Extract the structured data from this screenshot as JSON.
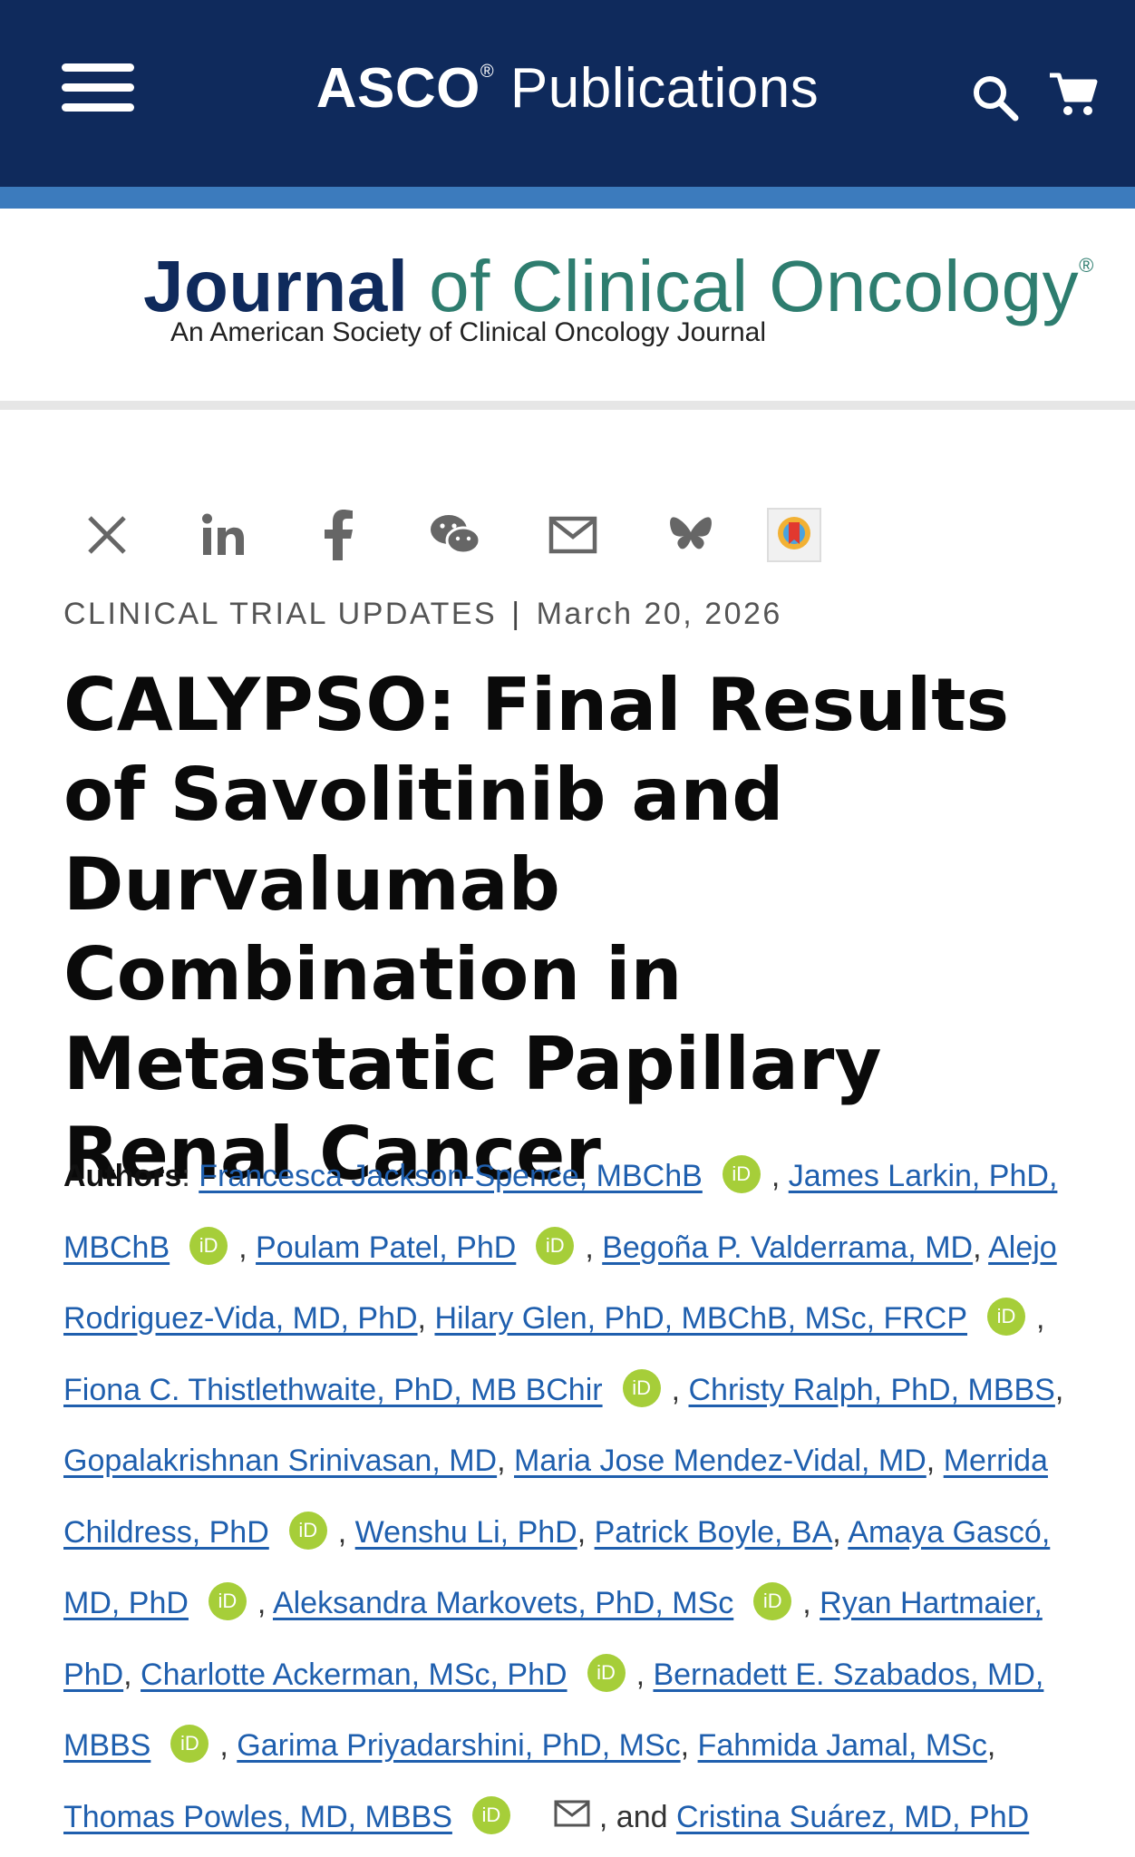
{
  "header": {
    "brand_bold": "ASCO",
    "brand_mark": "®",
    "brand_rest": " Publications",
    "menu_icon": "hamburger-icon",
    "search_icon": "search-icon",
    "cart_icon": "cart-icon"
  },
  "journal": {
    "title_bold": "Journal",
    "title_rest": " of Clinical Oncology",
    "registered": "®",
    "subtitle": "An American Society of Clinical Oncology Journal"
  },
  "share_icons": [
    "x-icon",
    "linkedin-icon",
    "facebook-icon",
    "wechat-icon",
    "email-icon",
    "bluesky-icon",
    "mendeley-icon"
  ],
  "article": {
    "category": "CLINICAL TRIAL UPDATES",
    "separator": "|",
    "date": "March 20, 2026",
    "title": "CALYPSO: Final Results of Savolitinib and Durvalumab Combination in Metastatic Papillary Renal Cancer"
  },
  "authors": {
    "label": "Authors",
    "orcid_text": "iD",
    "list": [
      "Francesca Jackson-Spence, MBChB",
      "James Larkin, PhD, MBChB",
      "Poulam Patel, PhD",
      "Begoña P. Valderrama, MD",
      "Alejo Rodriguez-Vida, MD, PhD",
      "Hilary Glen, PhD, MBChB, MSc, FRCP",
      "Fiona C. Thistlethwaite, PhD, MB BChir",
      "Christy Ralph, PhD, MBBS",
      "Gopalakrishnan Srinivasan, MD",
      "Maria Jose Mendez-Vidal, MD",
      "Merrida Childress, PhD",
      "Wenshu Li, PhD",
      "Patrick Boyle, BA",
      "Amaya Gascó, MD, PhD",
      "Aleksandra Markovets, PhD, MSc",
      "Ryan Hartmaier, PhD",
      "Charlotte Ackerman, MSc, PhD",
      "Bernadett E. Szabados, MD, MBBS",
      "Garima Priyadarshini, PhD, MSc",
      "Fahmida Jamal, MSc",
      "Thomas Powles, MD, MBBS",
      "Cristina Suárez, MD, PhD"
    ],
    "and_text": ", and "
  },
  "colors": {
    "header_bg": "#0f2a5c",
    "header_stripe": "#3c7bbd",
    "journal_green": "#2e7d6f",
    "link_blue": "#1f5fae",
    "orcid_green": "#a6ce39"
  }
}
